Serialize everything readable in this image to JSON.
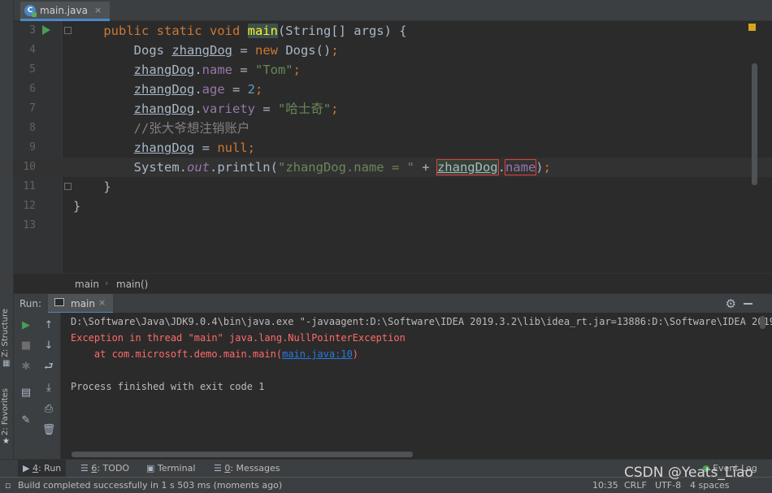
{
  "editor_tab": {
    "label": "main.java",
    "icon": "java-class-icon",
    "close": "×"
  },
  "code_lines": [
    {
      "num": "3",
      "parts": [
        [
          "kw",
          "public static void "
        ],
        [
          "hl",
          "main"
        ],
        [
          "p",
          "(String[] args) {"
        ]
      ]
    },
    {
      "num": "4",
      "parts": [
        [
          "p",
          "    Dogs "
        ],
        [
          "u",
          "zhangDog"
        ],
        [
          "p",
          " = "
        ],
        [
          "kw",
          "new "
        ],
        [
          "p",
          "Dogs()"
        ],
        [
          "kw",
          ";"
        ]
      ]
    },
    {
      "num": "5",
      "parts": [
        [
          "p",
          "    "
        ],
        [
          "u",
          "zhangDog"
        ],
        [
          "p",
          "."
        ],
        [
          "fld",
          "name"
        ],
        [
          "p",
          " = "
        ],
        [
          "str",
          "\"Tom\""
        ],
        [
          "kw",
          ";"
        ]
      ]
    },
    {
      "num": "6",
      "parts": [
        [
          "p",
          "    "
        ],
        [
          "u",
          "zhangDog"
        ],
        [
          "p",
          "."
        ],
        [
          "fld",
          "age"
        ],
        [
          "p",
          " = "
        ],
        [
          "num",
          "2"
        ],
        [
          "kw",
          ";"
        ]
      ]
    },
    {
      "num": "7",
      "parts": [
        [
          "p",
          "    "
        ],
        [
          "u",
          "zhangDog"
        ],
        [
          "p",
          "."
        ],
        [
          "fld",
          "variety"
        ],
        [
          "p",
          " = "
        ],
        [
          "str",
          "\"哈士奇\""
        ],
        [
          "kw",
          ";"
        ]
      ]
    },
    {
      "num": "8",
      "parts": [
        [
          "cmt",
          "    //张大爷想注销账户"
        ]
      ]
    },
    {
      "num": "9",
      "parts": [
        [
          "p",
          "    "
        ],
        [
          "u",
          "zhangDog"
        ],
        [
          "p",
          " = "
        ],
        [
          "kw",
          "null;"
        ]
      ]
    },
    {
      "num": "10",
      "parts": [
        [
          "p",
          "    System."
        ],
        [
          "fi",
          "out"
        ],
        [
          "p",
          ".println("
        ],
        [
          "str",
          "\"zhangDog.name = \""
        ],
        [
          "p",
          " + "
        ],
        [
          "uref",
          "zhangDog"
        ],
        [
          "p",
          "."
        ],
        [
          "fldbox",
          "name"
        ],
        [
          "p",
          ")"
        ],
        [
          "kw",
          ";"
        ]
      ]
    },
    {
      "num": "11",
      "parts": [
        [
          "p",
          "}"
        ]
      ]
    },
    {
      "num": "12",
      "parts": [
        [
          "p",
          "}"
        ]
      ]
    },
    {
      "num": "13",
      "parts": []
    }
  ],
  "breadcrumb": [
    "main",
    "main()"
  ],
  "run_panel": {
    "label": "Run:",
    "tab": "main",
    "tab_close": "×",
    "settings_icon": "gear-icon",
    "minimize_icon": "minus-icon"
  },
  "console": {
    "cmd": "D:\\Software\\Java\\JDK9.0.4\\bin\\java.exe \"-javaagent:D:\\Software\\IDEA 2019.3.2\\lib\\idea_rt.jar=13886:D:\\Software\\IDEA 2019.",
    "exception": "Exception in thread \"main\" java.lang.NullPointerException",
    "at_prefix": "    at com.microsoft.demo.main.main(",
    "at_link": "main.java:10",
    "at_suffix": ")",
    "finished": "Process finished with exit code 1"
  },
  "left_strip": {
    "structure": "Z: Structure",
    "favorites": "2: Favorites"
  },
  "tool_tabs": [
    {
      "key": "4",
      "label": ": Run",
      "icon": "play-icon"
    },
    {
      "key": "6",
      "label": ": TODO",
      "icon": "list-icon"
    },
    {
      "key": "",
      "label": "Terminal",
      "icon": "terminal-icon"
    },
    {
      "key": "0",
      "label": ": Messages",
      "icon": "messages-icon"
    }
  ],
  "event_log": "Event Log",
  "status": {
    "message": "Build completed successfully in 1 s 503 ms (moments ago)",
    "position": "10:35",
    "line_sep": "CRLF",
    "encoding": "UTF-8",
    "indent": "4 spaces"
  },
  "watermark": "CSDN @Yeats_Liao",
  "colors": {
    "accent": "#4a88c7",
    "error": "#ff6b68",
    "link": "#287bde",
    "run_green": "#499c54"
  }
}
